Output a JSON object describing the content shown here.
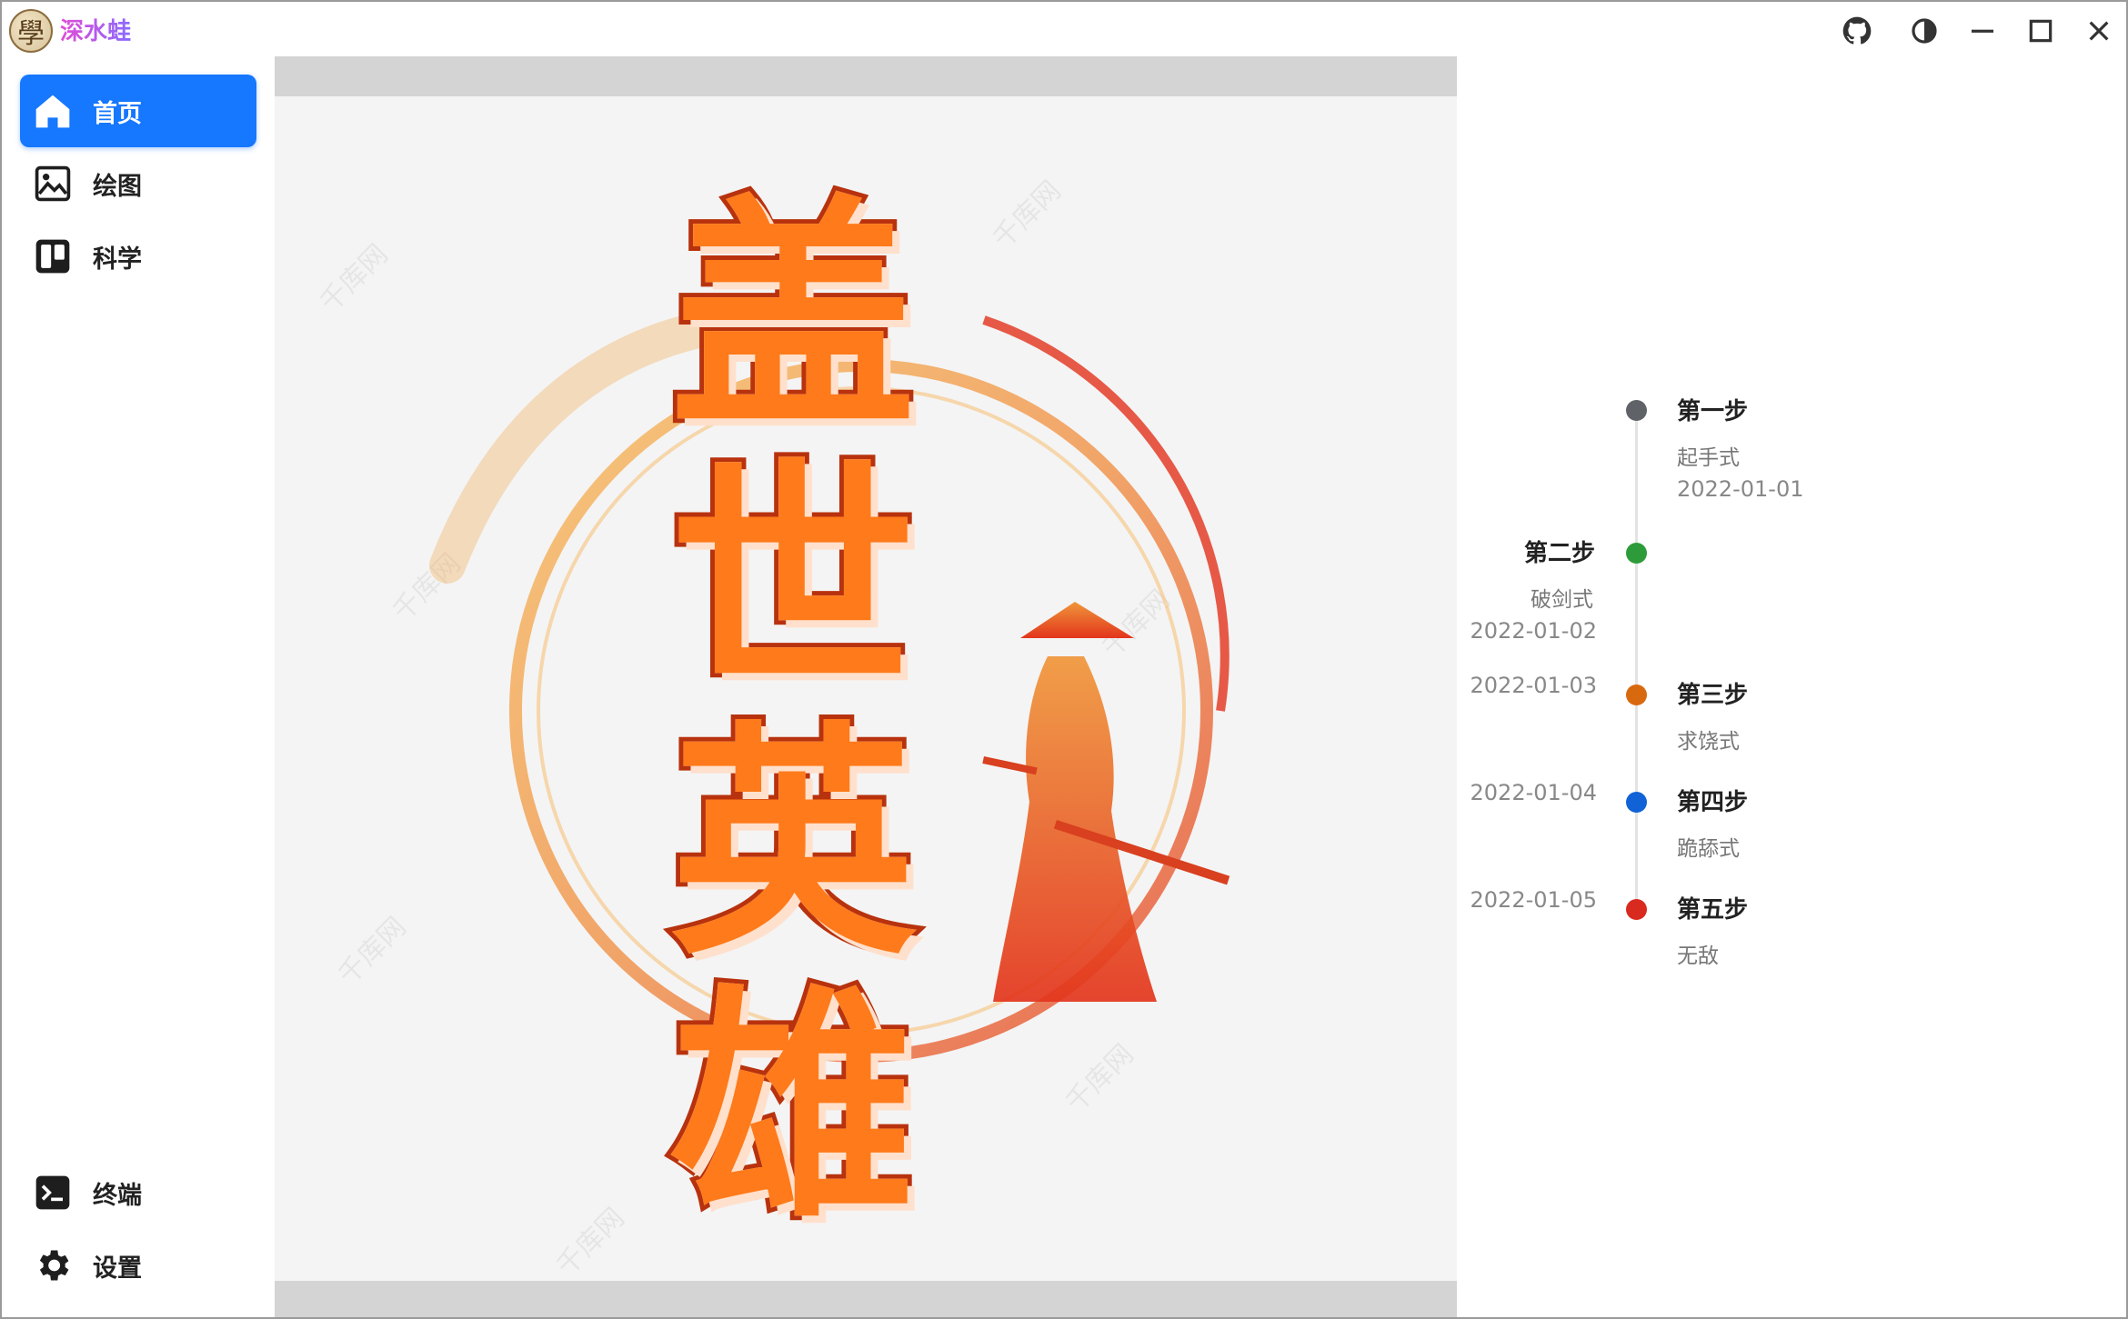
{
  "app": {
    "logo_glyph": "學",
    "name": "深水蛙"
  },
  "titlebar": {
    "icons": [
      "github-icon",
      "theme-toggle-icon",
      "minimize-icon",
      "maximize-icon",
      "close-icon"
    ]
  },
  "sidebar": {
    "items": [
      {
        "label": "首页",
        "icon": "home-icon",
        "active": true
      },
      {
        "label": "绘图",
        "icon": "image-icon"
      },
      {
        "label": "科学",
        "icon": "board-icon"
      },
      {
        "label": "终端",
        "icon": "terminal-icon"
      },
      {
        "label": "设置",
        "icon": "settings-gear-icon"
      }
    ],
    "accent": "#1677ff"
  },
  "banner": {
    "title_chars": [
      "盖",
      "世",
      "英",
      "雄"
    ],
    "watermark": "千库网"
  },
  "timeline": {
    "steps": [
      {
        "title": "第一步",
        "sub": "起手式",
        "date": "2022-01-01",
        "color": "#5f6368"
      },
      {
        "title": "第二步",
        "sub": "破剑式",
        "date": "2022-01-02",
        "color": "#2e9b3a"
      },
      {
        "title": "第三步",
        "sub": "求饶式",
        "date": "2022-01-03",
        "color": "#d9690f"
      },
      {
        "title": "第四步",
        "sub": "跪舔式",
        "date": "2022-01-04",
        "color": "#1062d6"
      },
      {
        "title": "第五步",
        "sub": "无敌",
        "date": "2022-01-05",
        "color": "#d82a1f"
      }
    ]
  }
}
